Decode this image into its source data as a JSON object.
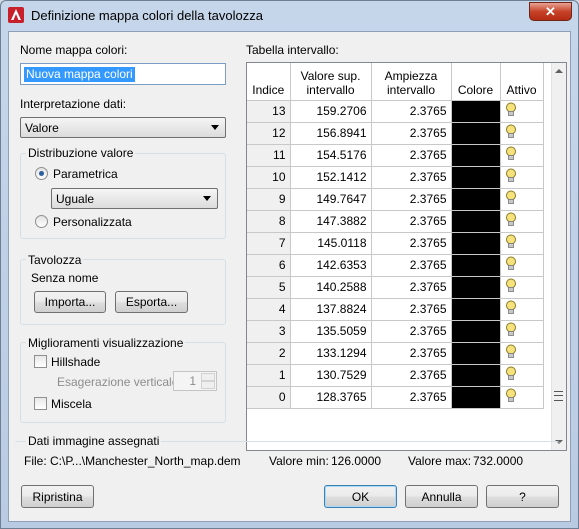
{
  "window": {
    "title": "Definizione mappa colori della tavolozza",
    "close_glyph": "✕"
  },
  "left": {
    "name_label": "Nome mappa colori:",
    "name_value": "Nuova mappa colori",
    "interp_label": "Interpretazione dati:",
    "interp_value": "Valore",
    "distribution": {
      "title": "Distribuzione valore",
      "parametric_label": "Parametrica",
      "parametric_selected": true,
      "param_value": "Uguale",
      "custom_label": "Personalizzata"
    },
    "palette": {
      "title": "Tavolozza",
      "name": "Senza nome",
      "import_label": "Importa...",
      "export_label": "Esporta..."
    },
    "enhancements": {
      "title": "Miglioramenti visualizzazione",
      "hillshade_label": "Hillshade",
      "vertical_exag_label": "Esagerazione verticale",
      "vertical_exag_value": "1",
      "blend_label": "Miscela"
    }
  },
  "table": {
    "label": "Tabella intervallo:",
    "headers": {
      "index": "Indice",
      "value_top": "Valore sup.",
      "value_bottom": "intervallo",
      "amp_top": "Ampiezza",
      "amp_bottom": "intervallo",
      "color": "Colore",
      "active": "Attivo"
    },
    "rows": [
      {
        "index": "13",
        "value": "159.2706",
        "amp": "2.3765",
        "color": "#000000",
        "active": true
      },
      {
        "index": "12",
        "value": "156.8941",
        "amp": "2.3765",
        "color": "#000000",
        "active": true
      },
      {
        "index": "11",
        "value": "154.5176",
        "amp": "2.3765",
        "color": "#000000",
        "active": true
      },
      {
        "index": "10",
        "value": "152.1412",
        "amp": "2.3765",
        "color": "#000000",
        "active": true
      },
      {
        "index": "9",
        "value": "149.7647",
        "amp": "2.3765",
        "color": "#000000",
        "active": true
      },
      {
        "index": "8",
        "value": "147.3882",
        "amp": "2.3765",
        "color": "#000000",
        "active": true
      },
      {
        "index": "7",
        "value": "145.0118",
        "amp": "2.3765",
        "color": "#000000",
        "active": true
      },
      {
        "index": "6",
        "value": "142.6353",
        "amp": "2.3765",
        "color": "#000000",
        "active": true
      },
      {
        "index": "5",
        "value": "140.2588",
        "amp": "2.3765",
        "color": "#000000",
        "active": true
      },
      {
        "index": "4",
        "value": "137.8824",
        "amp": "2.3765",
        "color": "#000000",
        "active": true
      },
      {
        "index": "3",
        "value": "135.5059",
        "amp": "2.3765",
        "color": "#000000",
        "active": true
      },
      {
        "index": "2",
        "value": "133.1294",
        "amp": "2.3765",
        "color": "#000000",
        "active": true
      },
      {
        "index": "1",
        "value": "130.7529",
        "amp": "2.3765",
        "color": "#000000",
        "active": true
      },
      {
        "index": "0",
        "value": "128.3765",
        "amp": "2.3765",
        "color": "#000000",
        "active": true
      }
    ]
  },
  "image_data": {
    "title": "Dati immagine assegnati",
    "file": "File:  C:\\P...\\Manchester_North_map.dem",
    "min_label": "Valore min:",
    "min_value": "126.0000",
    "max_label": "Valore max:",
    "max_value": "732.0000"
  },
  "buttons": {
    "reset": "Ripristina",
    "ok": "OK",
    "cancel": "Annulla",
    "help": "?"
  },
  "colors": {
    "accent": "#3399ff",
    "bulb": "#f5e27a"
  }
}
